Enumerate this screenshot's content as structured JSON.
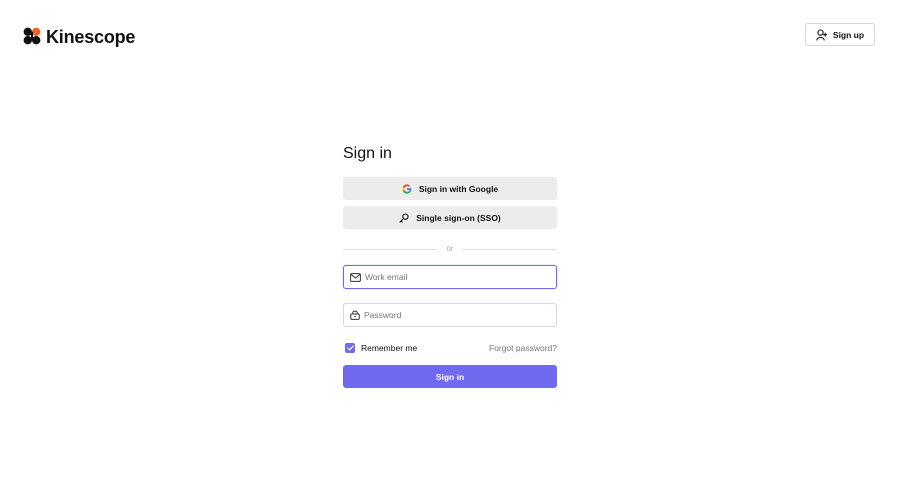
{
  "header": {
    "brand_name": "Kinescope",
    "brand_color": "#111111",
    "signup_label": "Sign up",
    "signup_icon": "user-plus-icon"
  },
  "form": {
    "title": "Sign in",
    "google_label": "Sign in with Google",
    "google_icon": "google-icon",
    "sso_label": "Single sign-on (SSO)",
    "sso_icon": "key-icon",
    "divider_text": "or",
    "email": {
      "placeholder": "Work email",
      "value": "",
      "icon": "mail-icon"
    },
    "password": {
      "placeholder": "Password",
      "value": "",
      "icon": "lock-icon"
    },
    "remember_label": "Remember me",
    "remember_checked": true,
    "forgot_label": "Forgot password?",
    "submit_label": "Sign in"
  },
  "colors": {
    "accent": "#6f6af0",
    "button_secondary_bg": "#ececec",
    "border": "#d8d8d8",
    "muted_text": "#777777"
  }
}
